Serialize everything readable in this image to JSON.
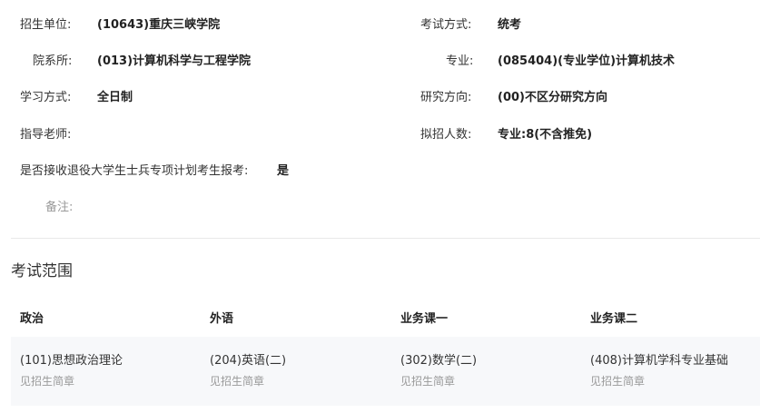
{
  "info": {
    "unit_label": "招生单位:",
    "unit_value": "(10643)重庆三峡学院",
    "exam_mode_label": "考试方式:",
    "exam_mode_value": "统考",
    "department_label": "院系所:",
    "department_value": "(013)计算机科学与工程学院",
    "major_label": "专业:",
    "major_value": "(085404)(专业学位)计算机技术",
    "study_mode_label": "学习方式:",
    "study_mode_value": "全日制",
    "research_label": "研究方向:",
    "research_value": "(00)不区分研究方向",
    "advisor_label": "指导老师:",
    "advisor_value": "",
    "quota_label": "拟招人数:",
    "quota_value": "专业:8(不含推免)",
    "veteran_label": "是否接收退役大学生士兵专项计划考生报考:",
    "veteran_value": "是",
    "remark_label": "备注:",
    "remark_value": ""
  },
  "exam_scope": {
    "title": "考试范围",
    "headers": [
      "政治",
      "外语",
      "业务课一",
      "业务课二"
    ],
    "row": [
      {
        "subject": "(101)思想政治理论",
        "note": "见招生简章"
      },
      {
        "subject": "(204)英语(二)",
        "note": "见招生简章"
      },
      {
        "subject": "(302)数学(二)",
        "note": "见招生简章"
      },
      {
        "subject": "(408)计算机学科专业基础",
        "note": "见招生简章"
      }
    ]
  }
}
